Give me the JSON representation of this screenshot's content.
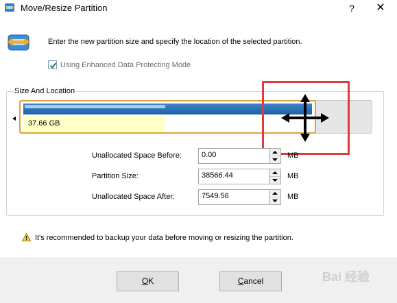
{
  "window": {
    "title": "Move/Resize Partition",
    "help_label": "?",
    "close_label": "✕"
  },
  "header": {
    "instruction": "Enter the new partition size and specify the location of the selected partition.",
    "checkbox_label": "Using Enhanced Data Protecting Mode",
    "checkbox_checked": true
  },
  "size_location": {
    "legend": "Size And Location",
    "partition_size_label": "37.66 GB",
    "used_fraction": 0.49
  },
  "fields": [
    {
      "label": "Unallocated Space Before:",
      "value": "0.00",
      "unit": "MB"
    },
    {
      "label": "Partition Size:",
      "value": "38566.44",
      "unit": "MB"
    },
    {
      "label": "Unallocated Space After:",
      "value": "7549.56",
      "unit": "MB"
    }
  ],
  "warning": {
    "text": "It's recommended to backup your data before moving or resizing the partition."
  },
  "buttons": {
    "ok_mnemonic": "O",
    "ok_rest": "K",
    "cancel_mnemonic": "C",
    "cancel_rest": "ancel"
  },
  "watermark": "Bai 经验",
  "colors": {
    "used_bar": "#1e5fa7",
    "partition_border": "#d9a43f",
    "free_space": "#ffffc8",
    "highlight": "#e03a3a"
  },
  "icons": [
    "partition-app-icon",
    "move-resize-icon",
    "check-icon",
    "move-cursor-icon",
    "warning-icon"
  ]
}
